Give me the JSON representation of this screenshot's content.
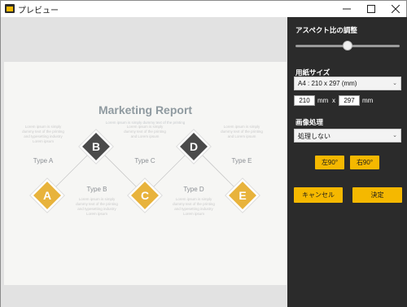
{
  "window": {
    "title": "プレビュー",
    "minimize_icon": "minimize-icon",
    "maximize_icon": "maximize-icon",
    "close_icon": "close-icon"
  },
  "preview": {
    "report_title": "Marketing Report",
    "report_subtitle": "Lorem ipsum is simply dummy text of the printing",
    "text_a": "Lorem ipsum is simply dummy text of the printing and typesetting industry Lorem ipsum",
    "text_c": "Lorem ipsum is simply dummy text of the printing and Lorem ipsum",
    "text_e": "Lorem ipsum is simply dummy text of the printing and Lorem ipsum",
    "text_b": "Lorem ipsum is simply dummy text of the printing and typesetting industry Lorem ipsum",
    "text_d": "Lorem ipsum is simply dummy text of the printing and typesetting industry Lorem ipsum",
    "diamonds": [
      "A",
      "B",
      "C",
      "D",
      "E"
    ],
    "types": [
      "Type A",
      "Type B",
      "Type C",
      "Type D",
      "Type E"
    ],
    "colors": {
      "dark": "#4a4a4a",
      "gold": "#e8b33c"
    }
  },
  "panel": {
    "aspect_label": "アスペクト比の調整",
    "aspect_value": 0.5,
    "paper_label": "用紙サイズ",
    "paper_value": "A4 : 210 x 297 (mm)",
    "width_value": "210",
    "width_unit": "mm",
    "times": "x",
    "height_value": "297",
    "height_unit": "mm",
    "image_label": "画像処理",
    "image_value": "処理しない",
    "rotate_left": "左90°",
    "rotate_right": "右90°",
    "cancel": "キャンセル",
    "ok": "決定",
    "accent": "#f5b800",
    "bg": "#2b2b2b"
  }
}
